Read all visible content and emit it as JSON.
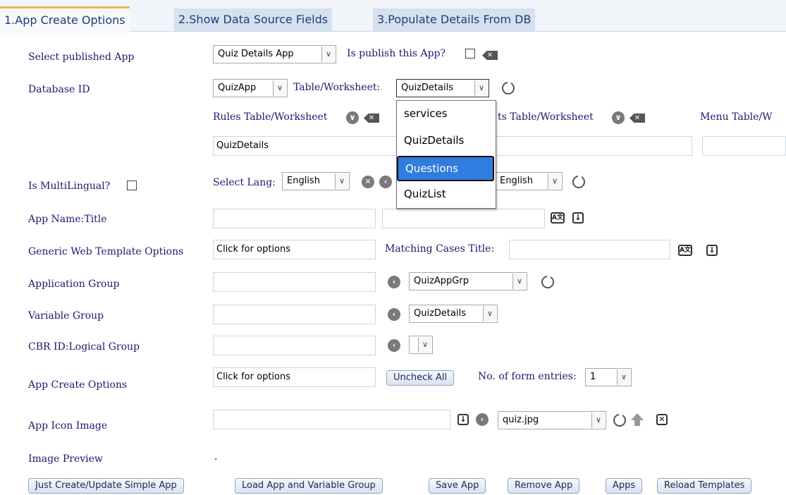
{
  "tabs": [
    "1.App Create Options",
    "2.Show Data Source Fields",
    "3.Populate Details From DB"
  ],
  "labels": {
    "select_app": "Select published App",
    "database_id": "Database ID",
    "is_multilingual": "Is MultiLingual?",
    "app_name_title": "App Name:Title",
    "generic_web": "Generic Web Template Options",
    "application_group": "Application Group",
    "variable_group": "Variable Group",
    "cbr_id": "CBR ID:Logical Group",
    "app_create_options": "App Create Options",
    "app_icon_image": "App Icon Image",
    "image_preview": "Image Preview",
    "is_publish": "Is publish this App?",
    "table_worksheet": "Table/Worksheet:",
    "rules_table": "Rules Table/Worksheet",
    "results_table_partial": "ts Table/Worksheet",
    "menu_table_partial": "Menu Table/W",
    "select_lang": "Select Lang:",
    "matching_cases": "Matching Cases Title:",
    "no_form_entries": "No. of form entries:"
  },
  "values": {
    "published_app": "Quiz Details App",
    "database": "QuizApp",
    "table": "QuizDetails",
    "rules_table_value": "QuizDetails",
    "lang1": "English",
    "lang2": "English",
    "generic_web_value": "Click for options",
    "app_group_select": "QuizAppGrp",
    "variable_group_select": "QuizDetails",
    "app_create_options_value": "Click for options",
    "form_entries": "1",
    "icon_select": "quiz.jpg",
    "image_preview_dot": "."
  },
  "dropdown_options": [
    "services",
    "QuizDetails",
    "Questions",
    "QuizList"
  ],
  "dropdown_highlighted": "Questions",
  "buttons": {
    "uncheck_all": "Uncheck All",
    "bottom": [
      "Just Create/Update Simple App",
      "Load App and Variable Group",
      "Save App",
      "Remove App",
      "Apps",
      "Reload Templates"
    ]
  },
  "colors": {
    "tab_active_border": "#f0b44c",
    "label_text": "#1a1a6e",
    "highlight": "#2f7ddf"
  }
}
